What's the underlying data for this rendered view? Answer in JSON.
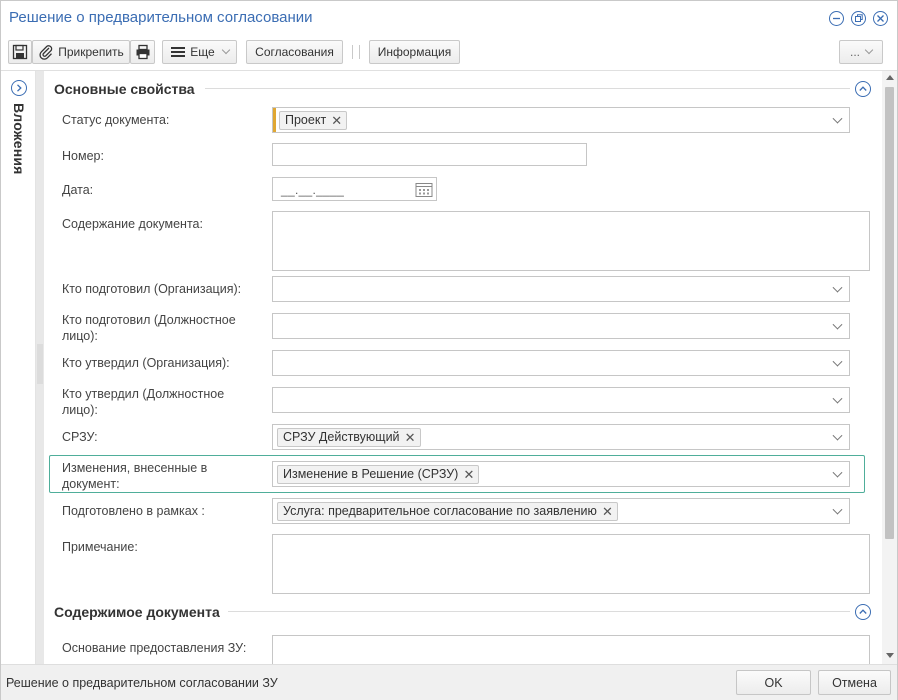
{
  "window": {
    "title": "Решение о предварительном согласовании"
  },
  "toolbar": {
    "attach_label": "Прикрепить",
    "more_label": "Еще",
    "approvals_label": "Согласования",
    "info_label": "Информация",
    "extra_label": "..."
  },
  "side_panel": {
    "label": "Вложения"
  },
  "sections": {
    "main": {
      "title": "Основные свойства"
    },
    "content": {
      "title": "Содержимое документа"
    }
  },
  "fields": {
    "status": {
      "label": "Статус документа:",
      "tag": "Проект"
    },
    "number": {
      "label": "Номер:",
      "value": ""
    },
    "date": {
      "label": "Дата:",
      "placeholder": "__.__.____"
    },
    "doc_content": {
      "label": "Содержание документа:",
      "value": ""
    },
    "prepared_org": {
      "label": "Кто подготовил (Организация):"
    },
    "prepared_person": {
      "label": "Кто подготовил (Должностное лицо):"
    },
    "approved_org": {
      "label": "Кто утвердил (Организация):"
    },
    "approved_person": {
      "label": "Кто утвердил (Должностное лицо):"
    },
    "srzu": {
      "label": "СРЗУ:",
      "tag": "СРЗУ Действующий"
    },
    "changes": {
      "label": "Изменения, внесенные в документ:",
      "tag": "Изменение в Решение (СРЗУ)"
    },
    "prepared_within": {
      "label": "Подготовлено в рамках :",
      "tag": "Услуга: предварительное согласование по заявлению"
    },
    "note": {
      "label": "Примечание:",
      "value": ""
    },
    "basis": {
      "label": "Основание предоставления ЗУ:",
      "value": ""
    }
  },
  "footer": {
    "status_text": "Решение о предварительном согласовании ЗУ",
    "ok_label": "OK",
    "cancel_label": "Отмена"
  },
  "colors": {
    "accent": "#3b6db3",
    "highlight": "#4fae9a",
    "required": "#e0a732"
  }
}
